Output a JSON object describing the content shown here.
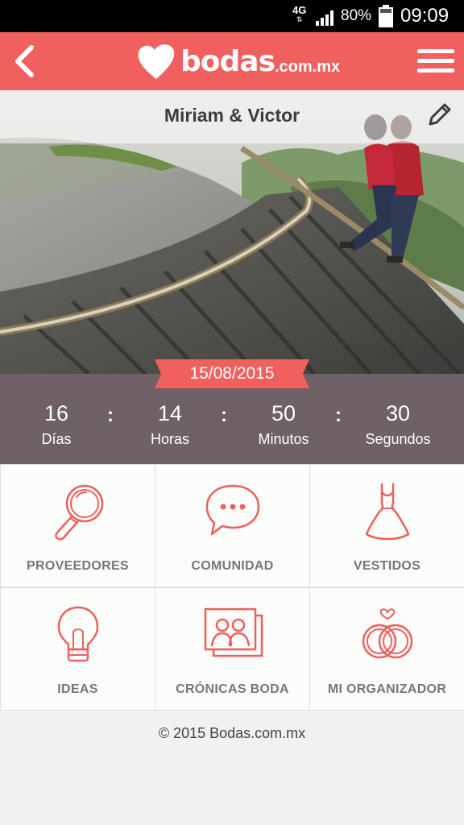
{
  "status_bar": {
    "network": "4G",
    "battery": "80%",
    "time": "09:09"
  },
  "header": {
    "logo_word": "bodas",
    "logo_tld": ".com.mx"
  },
  "couple": {
    "names": "Miriam & Victor"
  },
  "wedding_date": "15/08/2015",
  "countdown": {
    "days": {
      "value": "16",
      "label": "Días"
    },
    "hours": {
      "value": "14",
      "label": "Horas"
    },
    "minutes": {
      "value": "50",
      "label": "Minutos"
    },
    "seconds": {
      "value": "30",
      "label": "Segundos"
    },
    "separator": ":"
  },
  "tiles": [
    {
      "label": "PROVEEDORES",
      "icon": "magnifier-icon"
    },
    {
      "label": "COMUNIDAD",
      "icon": "chat-bubble-icon"
    },
    {
      "label": "VESTIDOS",
      "icon": "dress-icon"
    },
    {
      "label": "IDEAS",
      "icon": "lightbulb-icon"
    },
    {
      "label": "CRÓNICAS BODA",
      "icon": "photos-icon"
    },
    {
      "label": "MI ORGANIZADOR",
      "icon": "rings-icon"
    }
  ],
  "footer": {
    "copyright": "© 2015 Bodas.com.mx"
  },
  "colors": {
    "brand": "#f0605f",
    "countdown_bg": "#6e6168",
    "tile_bg": "#fbfdfb",
    "icon_stroke": "#ef5f5f"
  }
}
